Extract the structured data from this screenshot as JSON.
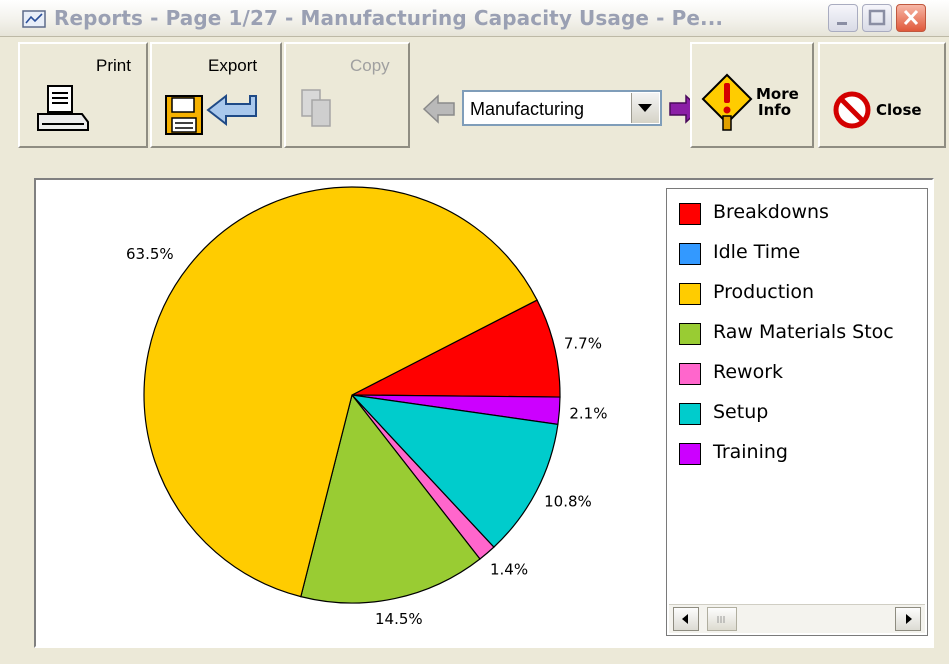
{
  "window": {
    "title": "Reports - Page 1/27 - Manufacturing Capacity Usage - Pe..."
  },
  "toolbar": {
    "print_label": "Print",
    "export_label": "Export",
    "copy_label": "Copy",
    "report_select_value": "Manufacturing",
    "more_info_label_line1": "More",
    "more_info_label_line2": "Info",
    "close_label": "Close"
  },
  "icons": {
    "print": "printer-icon",
    "export": "floppy-export-icon",
    "copy": "copy-icon",
    "prev": "left-arrow-icon",
    "next": "right-arrow-icon",
    "more_info": "exclamation-diamond-icon",
    "close": "no-sign-icon"
  },
  "chart_data": {
    "type": "pie",
    "slices": [
      {
        "name": "Breakdowns",
        "value": 7.7,
        "label": "7.7%",
        "color": "#ff0000"
      },
      {
        "name": "Training",
        "value": 2.1,
        "label": "2.1%",
        "color": "#cc00ff"
      },
      {
        "name": "Setup",
        "value": 10.8,
        "label": "10.8%",
        "color": "#00cccc"
      },
      {
        "name": "Rework",
        "value": 1.4,
        "label": "1.4%",
        "color": "#ff66cc"
      },
      {
        "name": "Raw Materials Stockout",
        "value": 14.5,
        "label": "14.5%",
        "color": "#99cc33"
      },
      {
        "name": "Production",
        "value": 63.5,
        "label": "63.5%",
        "color": "#ffcc00"
      }
    ]
  },
  "legend": {
    "items": [
      {
        "label": "Breakdowns",
        "color": "#ff0000"
      },
      {
        "label": "Idle Time",
        "color": "#3399ff"
      },
      {
        "label": "Production",
        "color": "#ffcc00"
      },
      {
        "label": "Raw Materials Stoc",
        "color": "#99cc33"
      },
      {
        "label": "Rework",
        "color": "#ff66cc"
      },
      {
        "label": "Setup",
        "color": "#00cccc"
      },
      {
        "label": "Training",
        "color": "#cc00ff"
      }
    ]
  }
}
